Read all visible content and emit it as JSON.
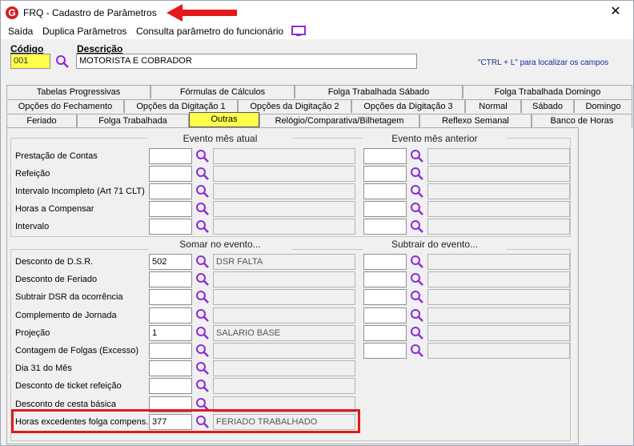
{
  "window": {
    "title": "FRQ - Cadastro de Parâmetros",
    "close_glyph": "✕",
    "logo_letter": "G"
  },
  "menu": [
    "Saída",
    "Duplica Parâmetros",
    "Consulta parâmetro do funcionário"
  ],
  "form": {
    "codigo_label": "Código",
    "codigo_value": "001",
    "descricao_label": "Descrição",
    "descricao_value": "MOTORISTA E COBRADOR",
    "hint": "\"CTRL + L\" para localizar os campos"
  },
  "tabs": {
    "row1": [
      "Tabelas Progressivas",
      "Fórmulas de Cálculos",
      "Folga Trabalhada Sábado",
      "Folga Trabalhada Domingo"
    ],
    "row2": [
      "Opções do Fechamento",
      "Opções da Digitação 1",
      "Opções da Digitação 2",
      "Opções da Digitação 3",
      "Normal",
      "Sábado",
      "Domingo"
    ],
    "row3": [
      "Feriado",
      "Folga Trabalhada",
      "Outras",
      "Relógio/Comparativa/Bilhetagem",
      "Reflexo Semanal",
      "Banco de Horas"
    ],
    "active": "Outras"
  },
  "section1": {
    "left_header": "Evento mês atual",
    "right_header": "Evento mês anterior",
    "rows": [
      {
        "label": "Prestação de Contas",
        "value": "",
        "desc": ""
      },
      {
        "label": "Refeição",
        "value": "",
        "desc": ""
      },
      {
        "label": "Intervalo Incompleto (Art 71 CLT)",
        "value": "",
        "desc": ""
      },
      {
        "label": "Horas a Compensar",
        "value": "",
        "desc": ""
      },
      {
        "label": "Intervalo",
        "value": "",
        "desc": ""
      }
    ]
  },
  "section2": {
    "left_header": "Somar no evento...",
    "right_header": "Subtrair do evento...",
    "rows": [
      {
        "label": "Desconto de D.S.R.",
        "value": "502",
        "desc": "DSR FALTA"
      },
      {
        "label": "Desconto de Feriado",
        "value": "",
        "desc": ""
      },
      {
        "label": "Subtrair DSR da ocorrência",
        "value": "",
        "desc": ""
      },
      {
        "label": "Complemento de Jornada",
        "value": "",
        "desc": ""
      },
      {
        "label": "Projeção",
        "value": "1",
        "desc": "SALARIO BASE"
      },
      {
        "label": "Contagem de Folgas (Excesso)",
        "value": "",
        "desc": ""
      },
      {
        "label": "Dia 31 do Mês",
        "value": "",
        "desc": ""
      },
      {
        "label": "Desconto de ticket refeição",
        "value": "",
        "desc": ""
      },
      {
        "label": "Desconto de cesta básica",
        "value": "",
        "desc": ""
      },
      {
        "label": "Horas excedentes folga compens.",
        "value": "377",
        "desc": "FERIADO TRABALHADO"
      }
    ]
  },
  "colors": {
    "accent_yellow": "#ffff4d",
    "highlight_red": "#e21a1a",
    "icon_purple": "#8a2bd8"
  },
  "icons": {
    "search": "search-icon",
    "monitor": "monitor-icon",
    "close": "close-icon"
  }
}
